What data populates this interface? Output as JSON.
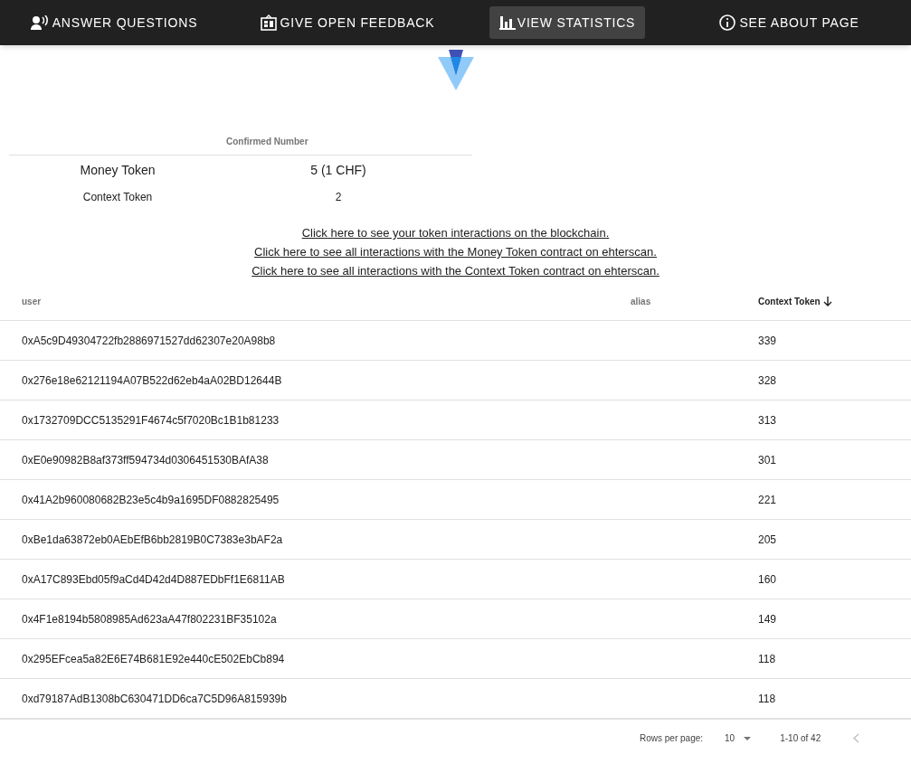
{
  "nav": [
    {
      "label": "ANSWER QUESTIONS",
      "kind": "voice",
      "selected": false
    },
    {
      "label": "GIVE OPEN FEEDBACK",
      "kind": "feedback",
      "selected": false
    },
    {
      "label": "VIEW STATISTICS",
      "kind": "chart",
      "selected": true
    },
    {
      "label": "SEE ABOUT PAGE",
      "kind": "info",
      "selected": false
    }
  ],
  "summary": {
    "columns": [
      "Confirmed Number"
    ],
    "rows": [
      {
        "name": "Money Token",
        "value": "5 (1 CHF)",
        "emphasis": true
      },
      {
        "name": "Context Token",
        "value": "2",
        "emphasis": false
      }
    ]
  },
  "links": [
    "Click here to see your token interactions on the blockchain.",
    "Click here to see all interactions with the Money Token contract on ehterscan.",
    "Click here to see all interactions with the Context Token contract on ehterscan."
  ],
  "table": {
    "columns": [
      {
        "label": "user",
        "sorted": false
      },
      {
        "label": "alias",
        "sorted": false
      },
      {
        "label": "Context Token",
        "sorted": true
      }
    ],
    "rows": [
      [
        "0xA5c9D49304722fb2886971527dd62307e20A98b8",
        "339"
      ],
      [
        "0x276e18e62121194A07B522d62eb4aA02BD12644B",
        "328"
      ],
      [
        "0x1732709DCC5135291F4674c5f7020Bc1B1b81233",
        "313"
      ],
      [
        "0xE0e90982B8af373ff594734d0306451530BAfA38",
        "301"
      ],
      [
        "0x41A2b960080682B23e5c4b9a1695DF0882825495",
        "221"
      ],
      [
        "0xBe1da63872eb0AEbEfB6bb2819B0C7383e3bAF2a",
        "205"
      ],
      [
        "0xA17C893Ebd05f9aCd4D42d4D887EDbFf1E6811AB",
        "160"
      ],
      [
        "0x4F1e8194b5808985Ad623aA47f802231BF35102a",
        "149"
      ],
      [
        "0x295EFcea5a82E6E74B681E92e440cE502EbCb894",
        "118"
      ],
      [
        "0xd79187AdB1308bC630471DD6ca7C5D96A815939b",
        "118"
      ]
    ]
  },
  "footer": {
    "rows_per_page_label": "Rows per page:",
    "rows_per_page": "10",
    "range": "1-10 of 42"
  }
}
